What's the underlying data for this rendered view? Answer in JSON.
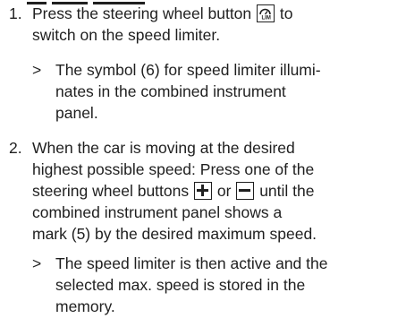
{
  "steps": [
    {
      "number": "1.",
      "text_before_icon": "Press the steering wheel button",
      "icon": "speed-limiter-button-icon",
      "text_after_icon": "to",
      "text_line2": "switch on the speed limiter.",
      "result_marker": ">",
      "result_lines": [
        "The symbol (6) for speed limiter illumi-",
        "nates in the combined instrument",
        "panel."
      ]
    },
    {
      "number": "2.",
      "lines": [
        "When the car is moving at the desired",
        "highest possible speed: Press one of the"
      ],
      "line3_before": "steering wheel buttons",
      "plus_icon": "plus-button-icon",
      "line3_mid": "or",
      "minus_icon": "minus-button-icon",
      "line3_after": "until the",
      "lines_after": [
        "combined instrument panel shows a",
        "mark (5) by the desired maximum speed."
      ],
      "result_marker": ">",
      "result_lines": [
        "The speed limiter is then active and the",
        "selected max. speed is stored in the",
        "memory."
      ]
    }
  ]
}
